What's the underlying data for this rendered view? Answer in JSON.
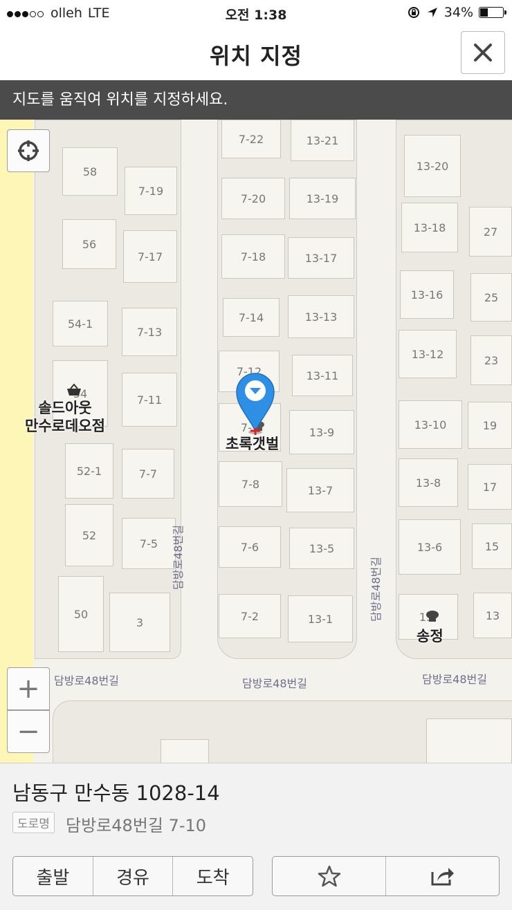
{
  "status_bar": {
    "carrier": "olleh",
    "network": "LTE",
    "time": "오전 1:38",
    "battery": "34%",
    "signal_dots": 5,
    "signal_strength": 3,
    "battery_level": 0.34
  },
  "header": {
    "title": "위치 지정",
    "close_icon": "close-icon"
  },
  "hint": "지도를 움직여 위치를 지정하세요.",
  "map": {
    "road_labels": {
      "vertical_left": "담방로48번길",
      "vertical_right": "담방로48번길",
      "h1": "담방로48번길",
      "h2": "담방로48번길",
      "h3": "담방로48번길"
    },
    "buildings": {
      "b58": "58",
      "b56": "56",
      "b54_1": "54-1",
      "b54": "54",
      "b52_1": "52-1",
      "b52": "52",
      "b50": "50",
      "b3": "3",
      "b7_19": "7-19",
      "b7_17": "7-17",
      "b7_13": "7-13",
      "b7_11": "7-11",
      "b7_7": "7-7",
      "b7_5": "7-5",
      "b7_22": "7-22",
      "b7_20": "7-20",
      "b7_18": "7-18",
      "b7_14": "7-14",
      "b7_12": "7-12",
      "b7_10": "7-1",
      "b7_8": "7-8",
      "b7_6": "7-6",
      "b7_2": "7-2",
      "b13_21": "13-21",
      "b13_19": "13-19",
      "b13_17": "13-17",
      "b13_13": "13-13",
      "b13_11": "13-11",
      "b13_9": "13-9",
      "b13_7": "13-7",
      "b13_5": "13-5",
      "b13_1": "13-1",
      "b13_20": "13-20",
      "b13_18": "13-18",
      "b13_16": "13-16",
      "b13_12": "13-12",
      "b13_10": "13-10",
      "b13_8": "13-8",
      "b13_6": "13-6",
      "b13_4": "13-",
      "b27": "27",
      "b25": "25",
      "b23": "23",
      "b19": "19",
      "b17": "17",
      "b15": "15",
      "b13": "13"
    },
    "pois": {
      "outlet_line1": "솔드아웃",
      "outlet_line2": "만수로데오점",
      "restaurant1": "초록갯벌",
      "restaurant2": "송정"
    },
    "controls": {
      "locate_icon": "crosshair-icon",
      "zoom_in": "+",
      "zoom_out": "−"
    },
    "pin_color": "#2f8fe5"
  },
  "info": {
    "address": "남동구 만수동 1028-14",
    "road_tag": "도로명",
    "road_address": "담방로48번길 7-10",
    "buttons": {
      "start": "출발",
      "via": "경유",
      "arrive": "도착"
    },
    "star_icon": "star-icon",
    "share_icon": "share-icon"
  }
}
